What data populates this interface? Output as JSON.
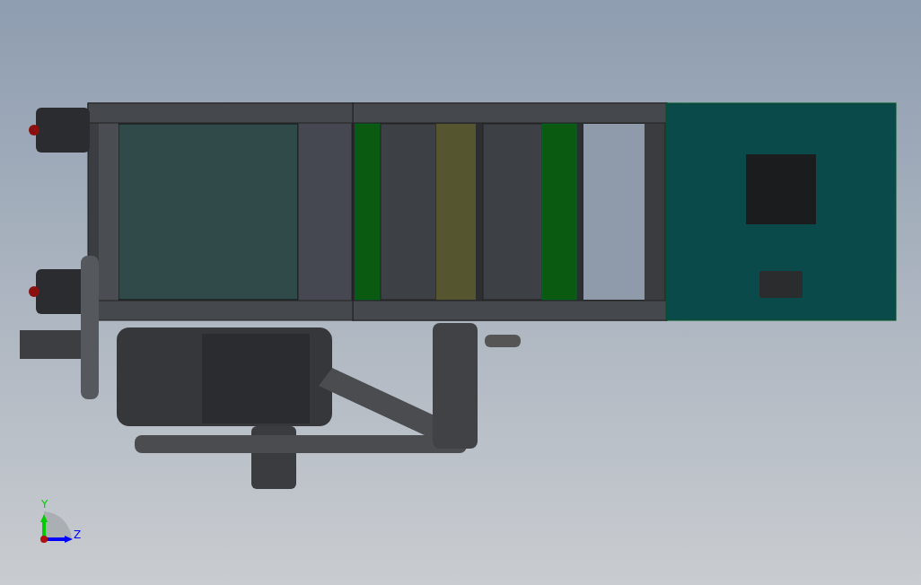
{
  "viewport": {
    "triad": {
      "axes": [
        {
          "label": "Y",
          "kind": "vertical",
          "color": "#00cc00"
        },
        {
          "label": "Z",
          "kind": "horizontal",
          "color": "#0000ff"
        }
      ]
    }
  }
}
